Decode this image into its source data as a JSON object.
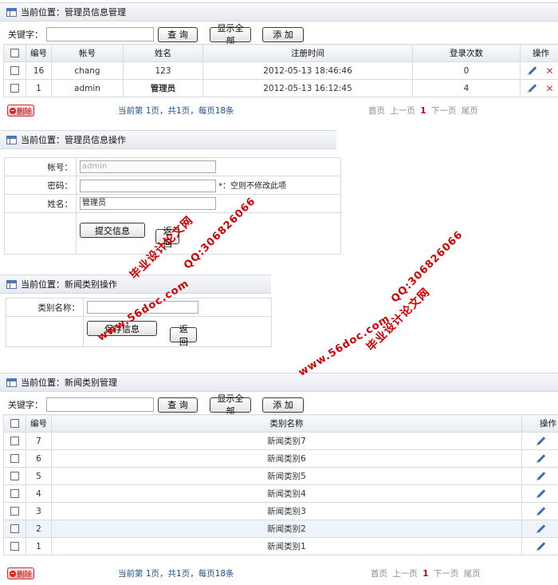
{
  "admin_list": {
    "title": "当前位置：管理员信息管理",
    "keyword_label": "关键字：",
    "search_button": "查  询",
    "show_all_button": "显示全部",
    "add_button": "添  加",
    "headers": [
      "编号",
      "帐号",
      "姓名",
      "注册时间",
      "登录次数",
      "操作"
    ],
    "rows": [
      {
        "id": "16",
        "account": "chang",
        "name": "123",
        "reg_time": "2012-05-13 18:46:46",
        "logins": "0"
      },
      {
        "id": "1",
        "account": "admin",
        "name": "管理员",
        "reg_time": "2012-05-13 16:12:45",
        "logins": "4"
      }
    ],
    "delete_button": "删除",
    "pager_info": "当前第  1页，共1页，每页18条",
    "pager_first": "首页",
    "pager_prev": "上一页",
    "pager_current": "1",
    "pager_next": "下一页",
    "pager_last": "尾页"
  },
  "admin_edit": {
    "title": "当前位置：管理员信息操作",
    "account_label": "帐号：",
    "account_value": "admin",
    "password_label": "密码：",
    "password_hint": "*：空则不修改此项",
    "name_label": "姓名：",
    "name_value": "管理员",
    "submit_button": "提交信息",
    "back_button": "返回"
  },
  "category_edit": {
    "title": "当前位置：新闻类别操作",
    "name_label": "类别名称：",
    "save_button": "保存信息",
    "back_button": "返回"
  },
  "category_list": {
    "title": "当前位置：新闻类别管理",
    "keyword_label": "关键字：",
    "search_button": "查  询",
    "show_all_button": "显示全部",
    "add_button": "添  加",
    "headers": [
      "编号",
      "类别名称",
      "操作"
    ],
    "rows": [
      {
        "id": "7",
        "name": "新闻类别7"
      },
      {
        "id": "6",
        "name": "新闻类别6"
      },
      {
        "id": "5",
        "name": "新闻类别5"
      },
      {
        "id": "4",
        "name": "新闻类别4"
      },
      {
        "id": "3",
        "name": "新闻类别3"
      },
      {
        "id": "2",
        "name": "新闻类别2"
      },
      {
        "id": "1",
        "name": "新闻类别1"
      }
    ],
    "delete_button": "删除",
    "pager_info": "当前第  1页，共1页，每页18条",
    "pager_first": "首页",
    "pager_prev": "上一页",
    "pager_current": "1",
    "pager_next": "下一页",
    "pager_last": "尾页"
  },
  "watermarks": {
    "w1a": "毕业设计论文网",
    "w1b": "QQ:306826066",
    "w1c": "www.56doc.com",
    "w2a": "www.56doc.com",
    "w2b": "QQ:306826066",
    "w2c": "毕业设计论文网"
  }
}
